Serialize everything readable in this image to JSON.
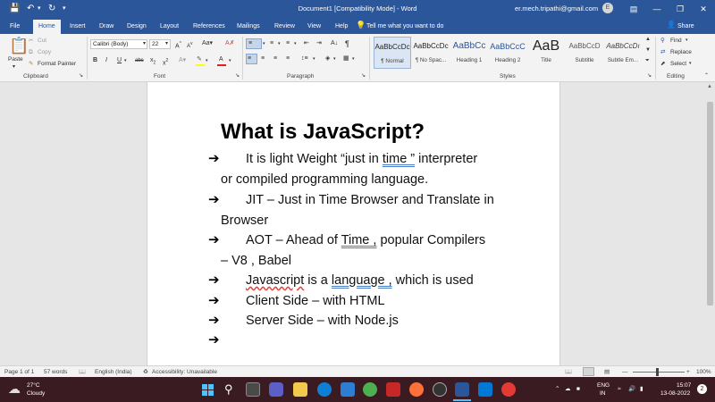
{
  "titlebar": {
    "title": "Document1 [Compatibility Mode] - Word",
    "account": "er.mech.tripathi@gmail.com",
    "avatar_initial": "E"
  },
  "tabs": [
    "File",
    "Home",
    "Insert",
    "Draw",
    "Design",
    "Layout",
    "References",
    "Mailings",
    "Review",
    "View",
    "Help"
  ],
  "tell_me": "Tell me what you want to do",
  "share_label": "Share",
  "ribbon": {
    "clipboard": {
      "paste": "Paste",
      "cut": "Cut",
      "copy": "Copy",
      "format_painter": "Format Painter",
      "label": "Clipboard"
    },
    "font": {
      "font_name": "Calibri (Body)",
      "font_size": "22",
      "label": "Font"
    },
    "paragraph": {
      "label": "Paragraph"
    },
    "styles": {
      "items": [
        {
          "preview": "AaBbCcDc",
          "name": "¶ Normal"
        },
        {
          "preview": "AaBbCcDc",
          "name": "¶ No Spac..."
        },
        {
          "preview": "AaBbCc",
          "name": "Heading 1"
        },
        {
          "preview": "AaBbCcC",
          "name": "Heading 2"
        },
        {
          "preview": "AaB",
          "name": "Title"
        },
        {
          "preview": "AaBbCcD",
          "name": "Subtitle"
        },
        {
          "preview": "AaBbCcDı",
          "name": "Subtle Em..."
        }
      ],
      "label": "Styles"
    },
    "editing": {
      "find": "Find",
      "replace": "Replace",
      "select": "Select",
      "label": "Editing"
    }
  },
  "document": {
    "heading": "What is JavaScript?",
    "lines": [
      {
        "a": "It is light Weight “just in ",
        "b": "time ”",
        "c": " interpreter"
      },
      {
        "a": "or compiled programming language."
      },
      {
        "a": "JIT – Just in Time Browser and Translate in"
      },
      {
        "a": "Browser"
      },
      {
        "a": "AOT – Ahead of ",
        "b": "Time  ,",
        "c": " popular Compilers"
      },
      {
        "a": "– V8 , Babel"
      },
      {
        "a": "Javascript",
        "b": " is a ",
        "c": "language ,",
        "d": " which is used"
      },
      {
        "a": "Client Side – with HTML"
      },
      {
        "a": "Server Side – with Node.js"
      }
    ]
  },
  "statusbar": {
    "page": "Page 1 of 1",
    "words": "57 words",
    "language": "English (India)",
    "accessibility": "Accessibility: Unavailable",
    "zoom": "100%"
  },
  "taskbar": {
    "temperature": "27°C",
    "weather": "Cloudy",
    "lang_line1": "ENG",
    "lang_line2": "IN",
    "time": "15:07",
    "date": "13-08-2022"
  },
  "colors": {
    "word_blue": "#2b579a",
    "taskbar": "#3b1b22"
  }
}
